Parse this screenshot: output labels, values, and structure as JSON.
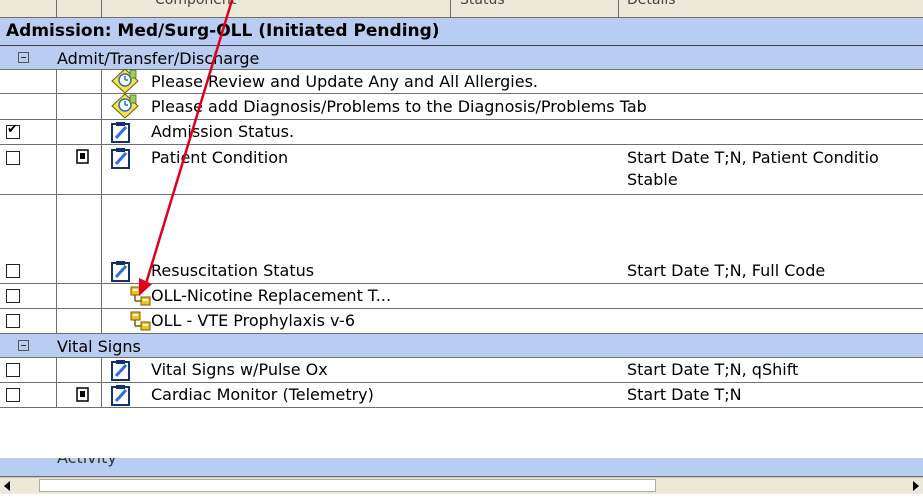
{
  "header": {
    "partial_left": "Component",
    "partial_mid": "Status",
    "partial_right": "Details"
  },
  "admission_title": "Admission: Med/Surg-OLL (Initiated Pending)",
  "groups": [
    {
      "label": "Admit/Transfer/Discharge",
      "items": [
        {
          "label": "Please Review and Update Any and All Allergies.",
          "detail": "",
          "icon": "reminder-icon"
        },
        {
          "label": "Please add Diagnosis/Problems to the Diagnosis/Problems Tab",
          "detail": "",
          "icon": "reminder-icon"
        },
        {
          "label": "Admission Status.",
          "detail": "",
          "icon": "order-clipboard-icon",
          "checked": true
        },
        {
          "label": "Patient Condition",
          "detail": "Start Date T;N, Patient Conditio",
          "detail2": "Stable",
          "icon": "order-clipboard-icon",
          "note_icon": true
        },
        {
          "label": "Resuscitation Status",
          "detail": "Start Date T;N, Full Code",
          "icon": "order-clipboard-icon"
        },
        {
          "label": "OLL-Nicotine Replacement T...",
          "detail": "",
          "icon": "subphase-icon"
        },
        {
          "label": "OLL - VTE Prophylaxis v-6",
          "detail": "",
          "icon": "subphase-icon"
        }
      ]
    },
    {
      "label": "Vital Signs",
      "items": [
        {
          "label": "Vital Signs w/Pulse Ox",
          "detail": "Start Date T;N, qShift",
          "icon": "order-clipboard-icon"
        },
        {
          "label": "Cardiac Monitor (Telemetry)",
          "detail": "Start Date T;N",
          "icon": "order-clipboard-icon",
          "note_icon": true
        }
      ]
    },
    {
      "label": "Activity",
      "items": []
    }
  ],
  "colors": {
    "group_bg": "#b9cdf2",
    "annotation_arrow": "#e0001b"
  }
}
